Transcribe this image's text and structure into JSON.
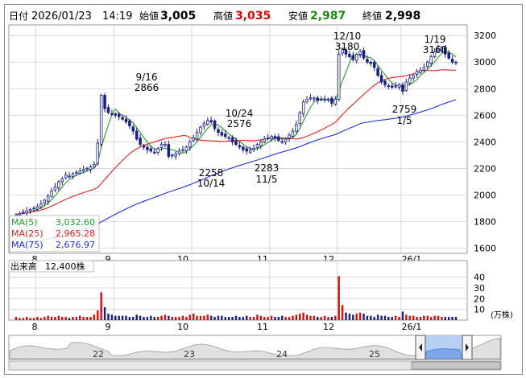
{
  "header": {
    "date_label": "日付",
    "date": "2026/01/23",
    "time": "14:19",
    "open_label": "始値",
    "open": "3,005",
    "high_label": "高値",
    "high": "3,035",
    "low_label": "安値",
    "low": "2,987",
    "close_label": "終値",
    "close": "2,998"
  },
  "colors": {
    "high": "#e00000",
    "low": "#1a8a1a",
    "up_candle": "#ffffff",
    "down_candle": "#1a2080",
    "ma5": "#2a9a2a",
    "ma25": "#e02020",
    "ma75": "#2030d0",
    "volume_up": "#d01010",
    "volume_down": "#1a2080"
  },
  "ma_legend": [
    {
      "label": "MA(5)",
      "value": "3,032.60",
      "color": "#2a9a2a"
    },
    {
      "label": "MA(25)",
      "value": "2,965.28",
      "color": "#e02020"
    },
    {
      "label": "MA(75)",
      "value": "2,676.97",
      "color": "#2030d0"
    }
  ],
  "volume_header": {
    "label": "出来高",
    "value": "12,400株"
  },
  "volume_unit": "(万株)",
  "navigator": {
    "year_labels": [
      "22",
      "23",
      "24",
      "25"
    ],
    "left_handle_icon": "left-arrow-icon",
    "right_handle_icon": "right-arrow-icon"
  },
  "chart_data": {
    "type": "candlestick",
    "x_labels": [
      "8",
      "9",
      "10",
      "11",
      "12",
      "26/1"
    ],
    "y_ticks": [
      1600,
      1800,
      2000,
      2200,
      2400,
      2600,
      2800,
      3000,
      3200
    ],
    "ylim": [
      1560,
      3280
    ],
    "volume_ticks": [
      10,
      20,
      30,
      40
    ],
    "volume_ylim": [
      0,
      45
    ],
    "grid": true,
    "annotations": [
      {
        "date": "9/16",
        "value": "2866",
        "kind": "high"
      },
      {
        "date": "10/14",
        "value": "2258",
        "kind": "low"
      },
      {
        "date": "10/24",
        "value": "2576",
        "kind": "high"
      },
      {
        "date": "11/5",
        "value": "2283",
        "kind": "low"
      },
      {
        "date": "12/10",
        "value": "3180",
        "kind": "high"
      },
      {
        "date": "1/5",
        "value": "2759",
        "kind": "low"
      },
      {
        "date": "1/19",
        "value": "3160",
        "kind": "high"
      }
    ],
    "closes": [
      1850,
      1860,
      1870,
      1880,
      1890,
      1900,
      1910,
      1930,
      1960,
      1990,
      2030,
      2060,
      2100,
      2120,
      2150,
      2140,
      2160,
      2170,
      2180,
      2190,
      2200,
      2210,
      2230,
      2390,
      2750,
      2650,
      2620,
      2610,
      2600,
      2590,
      2570,
      2550,
      2520,
      2480,
      2420,
      2380,
      2360,
      2340,
      2330,
      2320,
      2350,
      2380,
      2380,
      2290,
      2300,
      2310,
      2330,
      2340,
      2360,
      2400,
      2430,
      2470,
      2510,
      2540,
      2560,
      2550,
      2500,
      2470,
      2450,
      2440,
      2430,
      2400,
      2380,
      2360,
      2340,
      2330,
      2340,
      2350,
      2380,
      2400,
      2420,
      2430,
      2440,
      2430,
      2410,
      2400,
      2420,
      2450,
      2480,
      2530,
      2620,
      2700,
      2720,
      2730,
      2730,
      2710,
      2720,
      2720,
      2720,
      2690,
      2720,
      3060,
      3100,
      3060,
      3040,
      3020,
      3060,
      3080,
      3030,
      3000,
      2990,
      2960,
      2900,
      2850,
      2830,
      2820,
      2810,
      2820,
      2830,
      2780,
      2850,
      2880,
      2900,
      2930,
      2940,
      2960,
      3000,
      3040,
      3080,
      3100,
      3110,
      3060,
      3030,
      3000,
      2998
    ],
    "volumes": [
      3,
      2,
      2,
      3,
      2,
      2,
      3,
      2,
      3,
      4,
      3,
      3,
      4,
      3,
      3,
      2,
      3,
      3,
      4,
      3,
      3,
      3,
      5,
      9,
      26,
      12,
      6,
      5,
      4,
      4,
      4,
      4,
      3,
      3,
      5,
      4,
      3,
      3,
      4,
      3,
      3,
      4,
      5,
      4,
      3,
      3,
      3,
      4,
      3,
      5,
      6,
      4,
      4,
      4,
      5,
      4,
      3,
      4,
      4,
      3,
      3,
      3,
      4,
      3,
      3,
      4,
      3,
      3,
      5,
      4,
      3,
      3,
      4,
      3,
      3,
      4,
      3,
      3,
      4,
      5,
      6,
      7,
      5,
      4,
      4,
      3,
      3,
      4,
      3,
      3,
      4,
      41,
      14,
      7,
      6,
      5,
      6,
      7,
      6,
      4,
      4,
      3,
      5,
      4,
      4,
      3,
      3,
      4,
      3,
      8,
      5,
      4,
      4,
      3,
      3,
      4,
      4,
      3,
      4,
      4,
      3,
      3,
      3,
      3,
      3
    ]
  }
}
